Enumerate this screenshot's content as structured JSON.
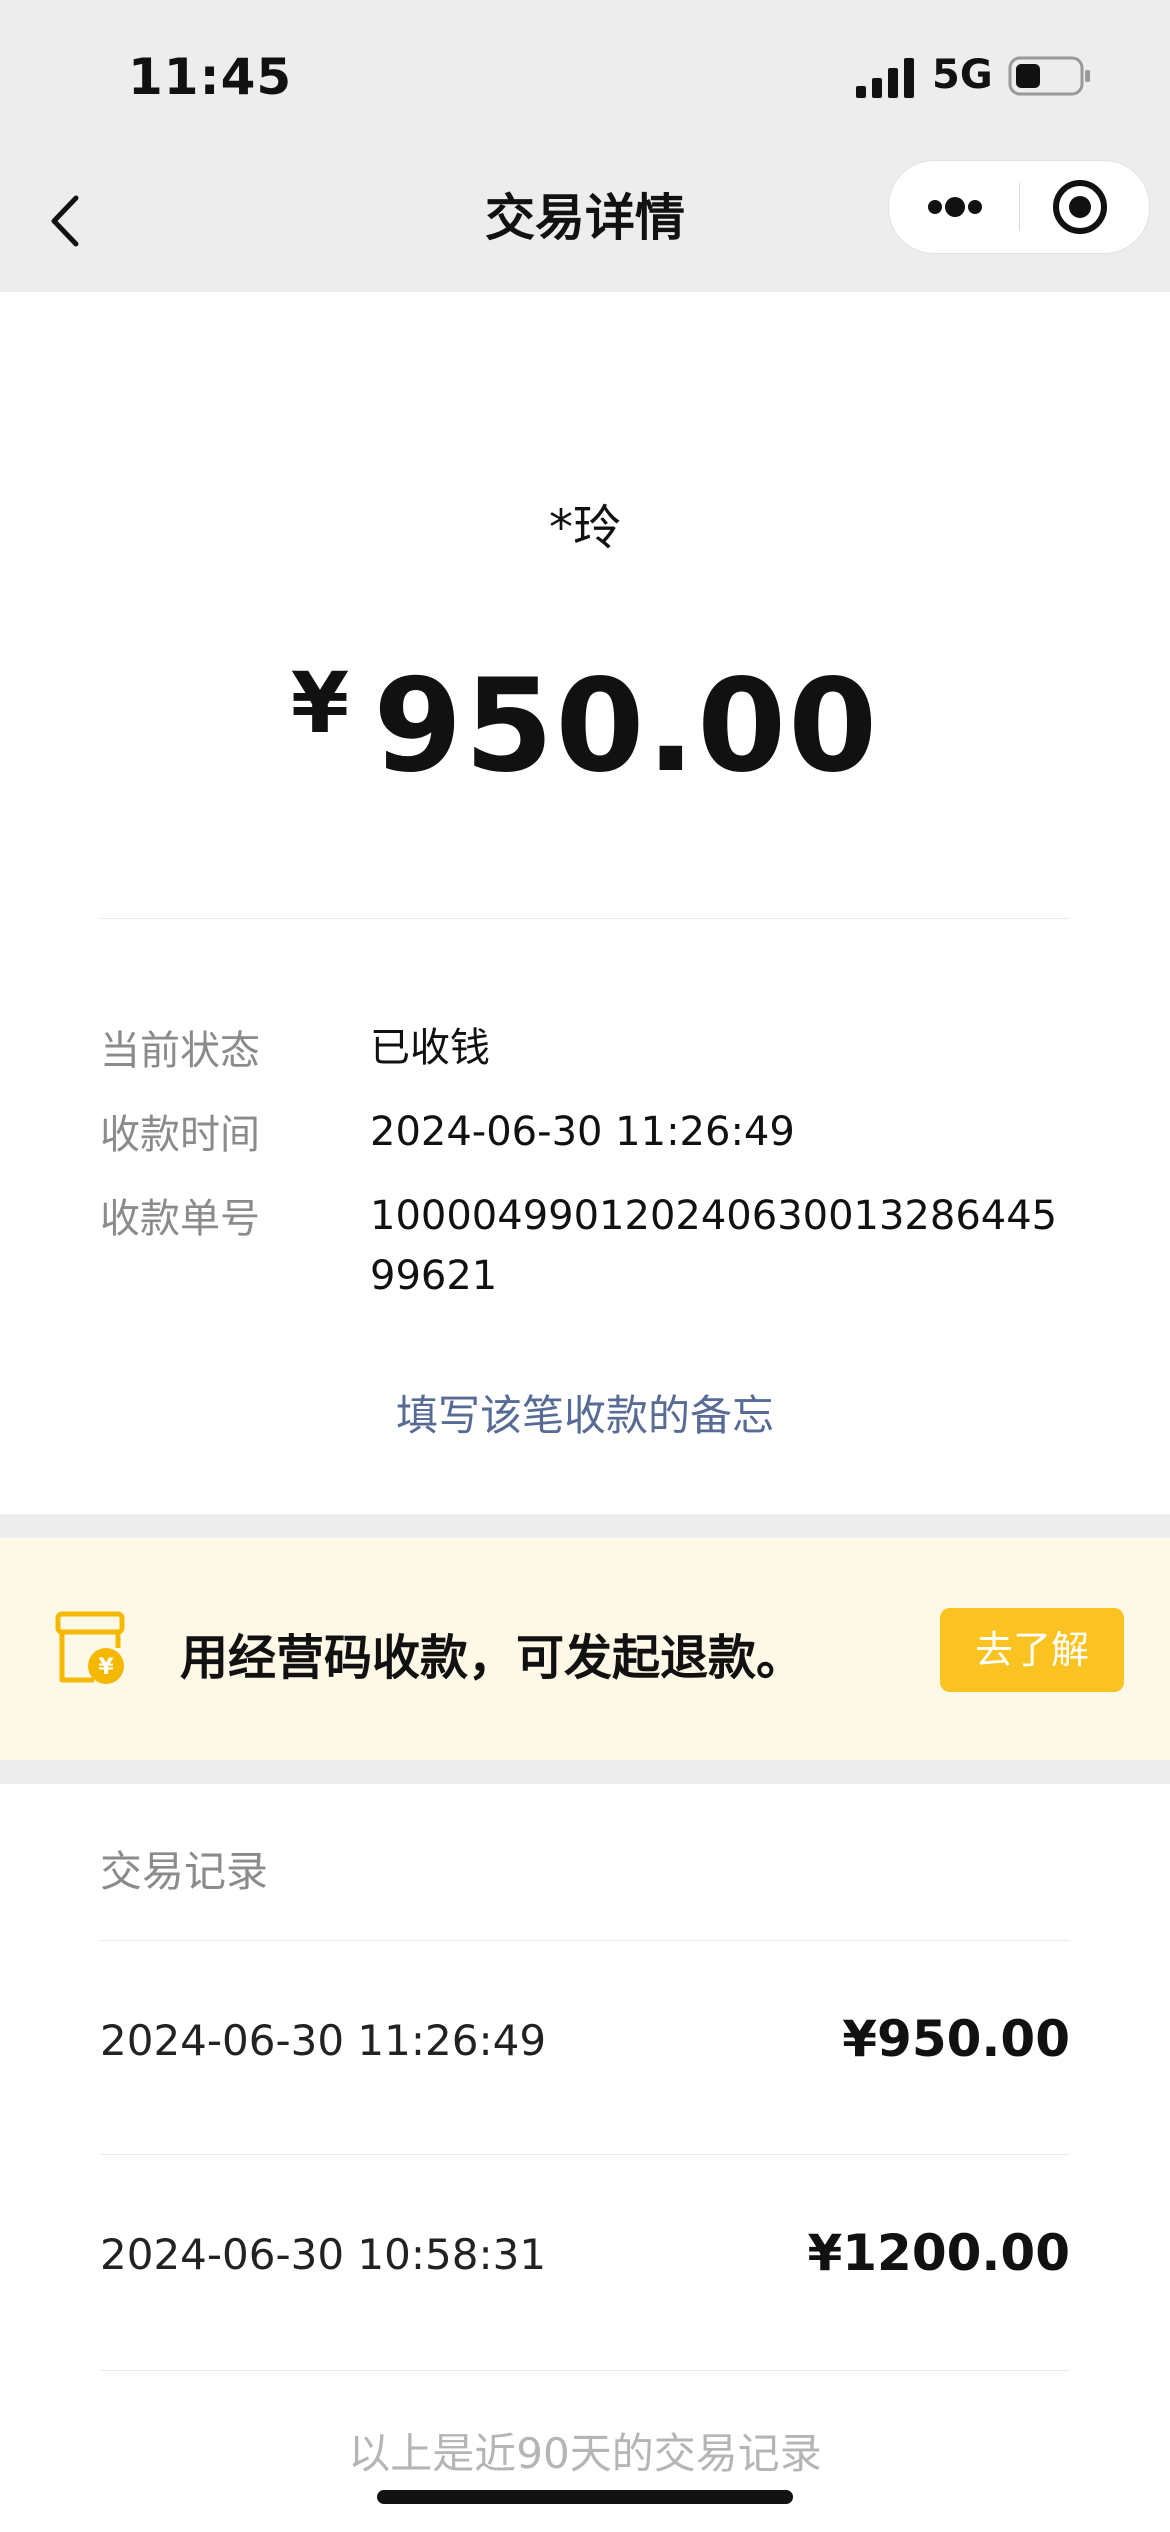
{
  "status_bar": {
    "time": "11:45",
    "network": "5G"
  },
  "nav": {
    "title": "交易详情"
  },
  "transaction": {
    "payer": "*玲",
    "currency_symbol": "¥",
    "amount": "950.00",
    "details": [
      {
        "label": "当前状态",
        "value": "已收钱"
      },
      {
        "label": "收款时间",
        "value": "2024-06-30 11:26:49"
      },
      {
        "label": "收款单号",
        "value": "100004990120240630013286445 99621"
      }
    ],
    "memo_link": "填写该笔收款的备忘"
  },
  "banner": {
    "text": "用经营码收款，可发起退款。",
    "button_label": "去了解",
    "accent_color": "#fbc321"
  },
  "records": {
    "title": "交易记录",
    "items": [
      {
        "time": "2024-06-30 11:26:49",
        "amount": "¥950.00"
      },
      {
        "time": "2024-06-30 10:58:31",
        "amount": "¥1200.00"
      }
    ],
    "footer": "以上是近90天的交易记录"
  }
}
